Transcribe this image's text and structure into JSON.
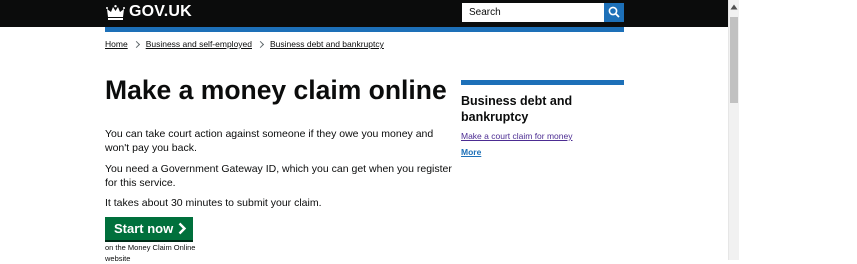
{
  "header": {
    "logo": "GOV.UK",
    "search": {
      "placeholder": "Search"
    }
  },
  "breadcrumb": [
    "Home",
    "Business and self-employed",
    "Business debt and bankruptcy"
  ],
  "main": {
    "title": "Make a money claim online",
    "paragraphs": [
      "You can take court action against someone if they owe you money and won't pay you back.",
      "You need a Government Gateway ID, which you can get when you register for this service.",
      "It takes about 30 minutes to submit your claim."
    ],
    "start_button": "Start now",
    "start_note": "on the Money Claim Online website"
  },
  "related": {
    "title": "Business debt and bankruptcy",
    "link": "Make a court claim for money",
    "more": "More"
  },
  "colors": {
    "header_bg": "#0b0c0c",
    "brand_blue": "#1d70b8",
    "start_green": "#00703c",
    "visited_link": "#4c2c92"
  },
  "icons": {
    "logo": "crown-icon",
    "search": "magnifier-icon",
    "start": "chevron-right-icon",
    "scroll_up": "triangle-up-icon"
  }
}
